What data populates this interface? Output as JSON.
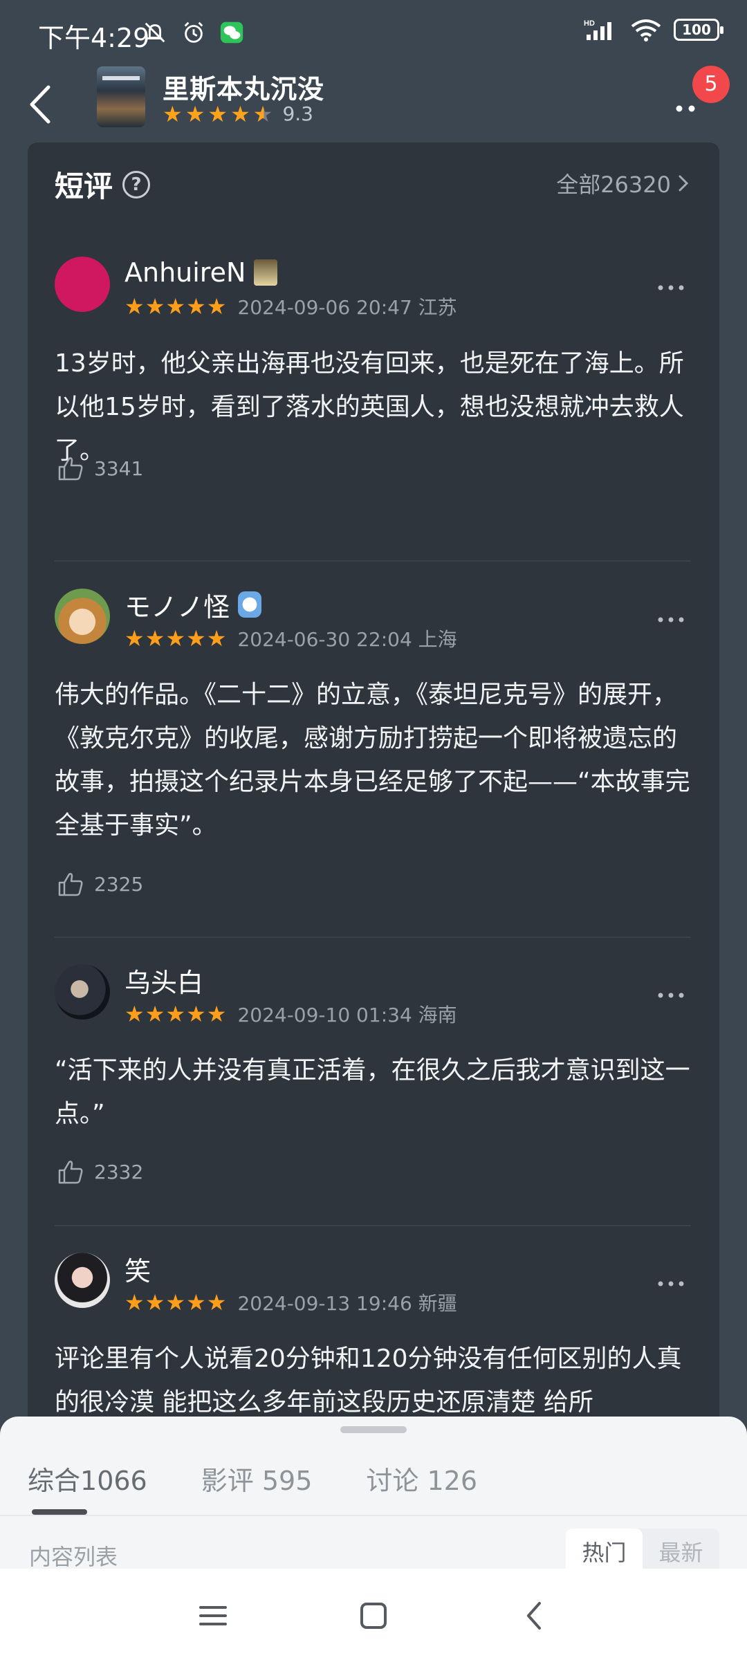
{
  "status_bar": {
    "time": "下午4:29",
    "battery": "100",
    "icons": [
      "mute-icon",
      "alarm-icon",
      "wechat-icon",
      "hd-signal-icon",
      "wifi-icon",
      "battery-icon"
    ]
  },
  "header": {
    "title": "里斯本丸沉没",
    "score": "9.3",
    "notification_count": "5"
  },
  "short_reviews": {
    "section_title": "短评",
    "all_link": "全部26320"
  },
  "reviews": [
    {
      "user": "AnhuireN",
      "date": "2024-09-06 20:47 江苏",
      "text": "13岁时，他父亲出海再也没有回来，也是死在了海上。所以他15岁时，看到了落水的英国人，想也没想就冲去救人了。",
      "likes": "3341",
      "avatar_color": "#d0185e"
    },
    {
      "user": "モノノ怪",
      "date": "2024-06-30 22:04 上海",
      "text": "伟大的作品。《二十二》的立意，《泰坦尼克号》的展开，《敦克尔克》的收尾，感谢方励打捞起一个即将被遗忘的故事，拍摄这个纪录片本身已经足够了不起——“本故事完全基于事实”。",
      "likes": "2325"
    },
    {
      "user": "乌头白",
      "date": "2024-09-10 01:34 海南",
      "text": "“活下来的人并没有真正活着，在很久之后我才意识到这一点。”",
      "likes": "2332"
    },
    {
      "user": "笑",
      "date": "2024-09-13 19:46 新疆",
      "text": "评论里有个人说看20分钟和120分钟没有任何区别的人真的很冷漠 能把这么多年前这段历史还原清楚 给所"
    }
  ],
  "bottom_sheet": {
    "tabs": [
      {
        "label": "综合",
        "count": "1066"
      },
      {
        "label": "影评",
        "count": "595"
      },
      {
        "label": "讨论",
        "count": "126"
      }
    ],
    "list_label": "内容列表",
    "sort_hot": "热门",
    "sort_new": "最新"
  },
  "colors": {
    "page_bg": "#3b4651",
    "card_bg": "#2e353c",
    "star": "#ff9e1b",
    "badge": "#f2484b"
  }
}
